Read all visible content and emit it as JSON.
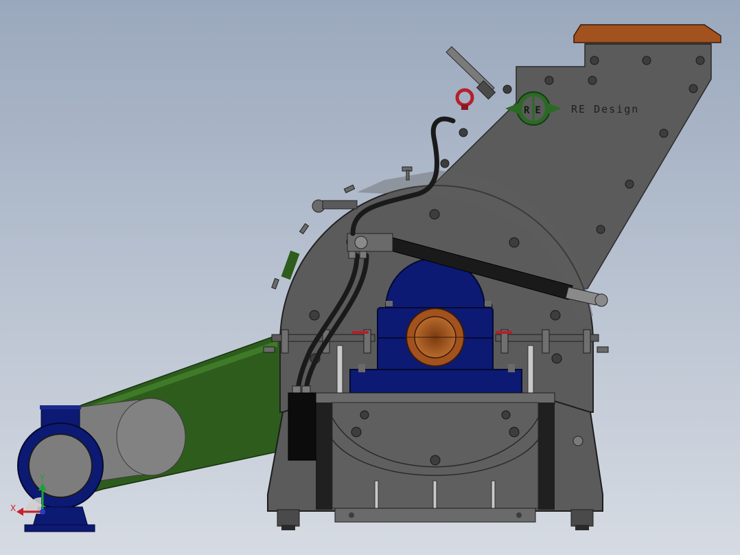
{
  "scene": {
    "brand_logo_letters": "RE",
    "brand_name": "RE Design",
    "triad": {
      "x_label": "X",
      "y_label": "Y"
    }
  },
  "colors": {
    "background_top": "#9aa8bd",
    "background_bottom": "#d6dbe3",
    "body_gray": "#5b5b5b",
    "belt_green": "#2d5c1c",
    "bearing_blue": "#0c1a74",
    "copper": "#a2521e",
    "logo_green": "#2b6a25",
    "eyebolt_red": "#b5202a",
    "axis_x": "#c8202a",
    "axis_y": "#1fa13a",
    "axis_z": "#2d3bc2"
  }
}
